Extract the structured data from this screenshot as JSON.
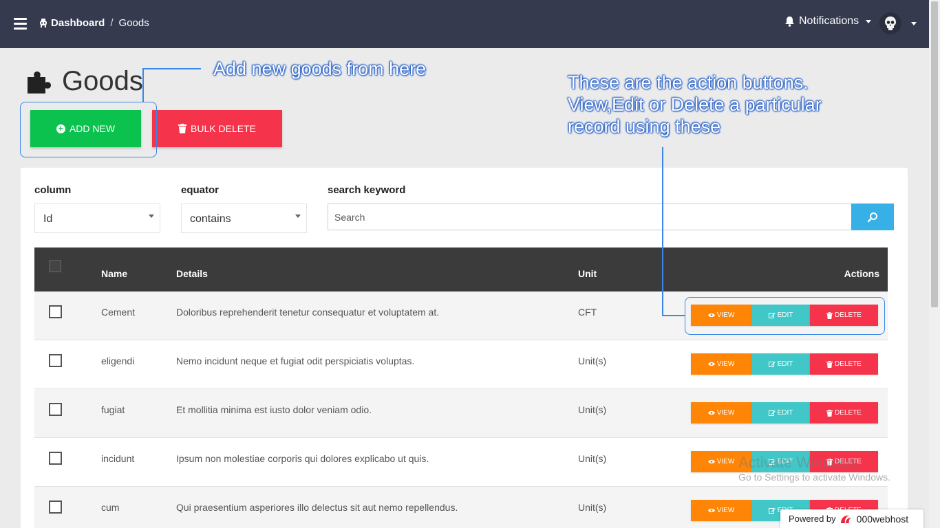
{
  "nav": {
    "breadcrumb_home": "Dashboard",
    "breadcrumb_sep": "/",
    "breadcrumb_current": "Goods",
    "notifications_label": "Notifications"
  },
  "page": {
    "title": "Goods",
    "add_button": "ADD NEW",
    "bulk_delete_button": "BULK DELETE"
  },
  "annotations": {
    "add_hint": "Add new goods from here",
    "actions_hint_1": "These are the action buttons.",
    "actions_hint_2": "View,Edit or Delete a particular",
    "actions_hint_3": "record using these"
  },
  "filters": {
    "column_label": "column",
    "column_value": "Id",
    "equator_label": "equator",
    "equator_value": "contains",
    "search_label": "search keyword",
    "search_placeholder": "Search"
  },
  "table": {
    "headers": {
      "name": "Name",
      "details": "Details",
      "unit": "Unit",
      "actions": "Actions"
    },
    "view_label": "VIEW",
    "edit_label": "EDIT",
    "delete_label": "DELETE",
    "rows": [
      {
        "name": "Cement",
        "details": "Doloribus reprehenderit tenetur consequatur et voluptatem at.",
        "unit": "CFT"
      },
      {
        "name": "eligendi",
        "details": "Nemo incidunt neque et fugiat odit perspiciatis voluptas.",
        "unit": "Unit(s)"
      },
      {
        "name": "fugiat",
        "details": "Et mollitia minima est iusto dolor veniam odio.",
        "unit": "Unit(s)"
      },
      {
        "name": "incidunt",
        "details": "Ipsum non molestiae corporis qui dolores explicabo ut quis.",
        "unit": "Unit(s)"
      },
      {
        "name": "cum",
        "details": "Qui praesentium asperiores illo delectus sit aut nemo repellendus.",
        "unit": "Unit(s)"
      }
    ]
  },
  "watermark": {
    "line1": "Activate Windows",
    "line2": "Go to Settings to activate Windows."
  },
  "powered": {
    "prefix": "Powered by",
    "brand": "000webhost"
  },
  "colors": {
    "navbar": "#353a4e",
    "add": "#0ac24d",
    "danger": "#f5334a",
    "view": "#ff8506",
    "edit": "#41c7c8",
    "search": "#36b0e6",
    "annotation": "#3a87e8"
  }
}
